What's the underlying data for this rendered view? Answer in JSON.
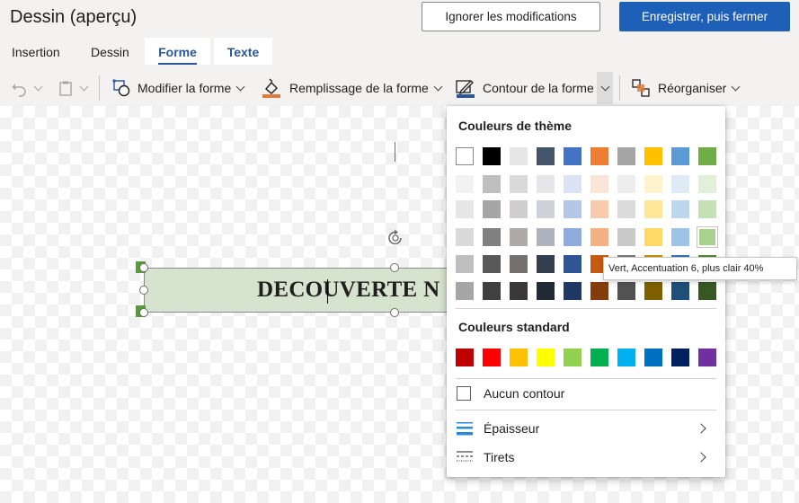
{
  "window": {
    "title": "Dessin (aperçu)"
  },
  "actions": {
    "discard_label": "Ignorer les modifications",
    "save_label": "Enregistrer, puis fermer"
  },
  "tabs": [
    {
      "label": "Insertion",
      "active": false
    },
    {
      "label": "Dessin",
      "active": false
    },
    {
      "label": "Forme",
      "active": true
    },
    {
      "label": "Texte",
      "active": false
    }
  ],
  "ribbon": {
    "undo_icon": "undo-icon",
    "paste_icon": "clipboard-icon",
    "modify_shape_label": "Modifier la forme",
    "fill_label": "Remplissage de la forme",
    "outline_label": "Contour de la forme",
    "arrange_label": "Réorganiser",
    "fill_color": "#e07a3a",
    "outline_color": "#2b579a"
  },
  "shape": {
    "text": "DECOUVERTE N",
    "fill": "#d6e3cf"
  },
  "dropdown": {
    "theme_header": "Couleurs de thème",
    "theme_colors": [
      [
        "#ffffff",
        "#000000",
        "#e7e6e6",
        "#44546a",
        "#4472c4",
        "#ed7d31",
        "#a5a5a5",
        "#ffc000",
        "#5b9bd5",
        "#70ad47"
      ],
      [
        "#f2f2f2",
        "#bfbfbf",
        "#d9d9d9",
        "#e5e7ea",
        "#dae3f3",
        "#fbe5d6",
        "#ededed",
        "#fff2cc",
        "#deebf7",
        "#e2f0d9"
      ],
      [
        "#e6e6e6",
        "#a6a6a6",
        "#cfcdcd",
        "#cfd2d8",
        "#b4c7e7",
        "#f8cbad",
        "#dbdbdb",
        "#ffe699",
        "#bdd7ee",
        "#c5e0b4"
      ],
      [
        "#d9d9d9",
        "#808080",
        "#aeaaaa",
        "#adb4be",
        "#8faadc",
        "#f4b183",
        "#c9c9c9",
        "#ffd966",
        "#9dc3e6",
        "#a9d18e"
      ],
      [
        "#bfbfbf",
        "#595959",
        "#767171",
        "#333f50",
        "#2f5597",
        "#c55a11",
        "#7b7b7b",
        "#bf9000",
        "#2e75b6",
        "#548235"
      ],
      [
        "#a6a6a6",
        "#404040",
        "#3a3838",
        "#222a35",
        "#203864",
        "#843c0c",
        "#525252",
        "#7f6000",
        "#1f4e79",
        "#385723"
      ]
    ],
    "standard_header": "Couleurs standard",
    "standard_colors": [
      "#c00000",
      "#ff0000",
      "#ffc000",
      "#ffff00",
      "#92d050",
      "#00b050",
      "#00b0f0",
      "#0070c0",
      "#002060",
      "#7030a0"
    ],
    "no_outline_label": "Aucun contour",
    "weight_label": "Épaisseur",
    "dashes_label": "Tirets"
  },
  "tooltip": {
    "text": "Vert, Accentuation 6, plus clair 40%"
  }
}
